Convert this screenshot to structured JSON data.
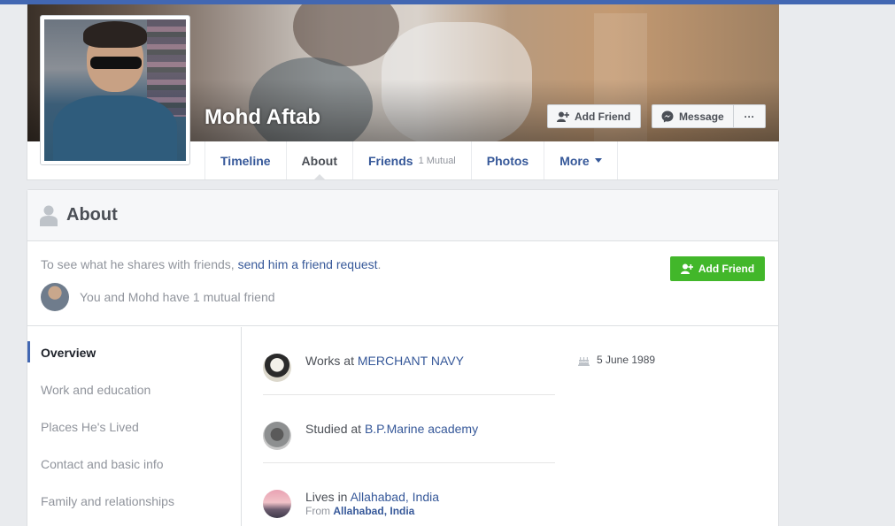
{
  "profile": {
    "name": "Mohd Aftab",
    "add_friend_label": "Add Friend",
    "message_label": "Message",
    "more_dots": "···"
  },
  "tabs": [
    {
      "label": "Timeline"
    },
    {
      "label": "About"
    },
    {
      "label": "Friends",
      "count": "1 Mutual"
    },
    {
      "label": "Photos"
    },
    {
      "label": "More"
    }
  ],
  "about": {
    "title": "About",
    "intro_prefix": "To see what he shares with friends, ",
    "intro_link": "send him a friend request",
    "intro_suffix": ".",
    "mutual_text": "You and Mohd have 1 mutual friend",
    "add_friend_label": "Add Friend"
  },
  "sidebar": {
    "items": [
      {
        "label": "Overview"
      },
      {
        "label": "Work and education"
      },
      {
        "label": "Places He's Lived"
      },
      {
        "label": "Contact and basic info"
      },
      {
        "label": "Family and relationships"
      }
    ]
  },
  "overview": {
    "work": {
      "prefix": "Works at ",
      "link": "MERCHANT NAVY"
    },
    "study": {
      "prefix": "Studied at ",
      "link": "B.P.Marine academy"
    },
    "lives": {
      "prefix": "Lives in ",
      "link": "Allahabad, India",
      "from_prefix": "From ",
      "from_link": "Allahabad, India"
    },
    "birthday": "5 June 1989"
  },
  "colors": {
    "accent": "#4267b2",
    "link": "#365899",
    "green": "#42b72a"
  }
}
